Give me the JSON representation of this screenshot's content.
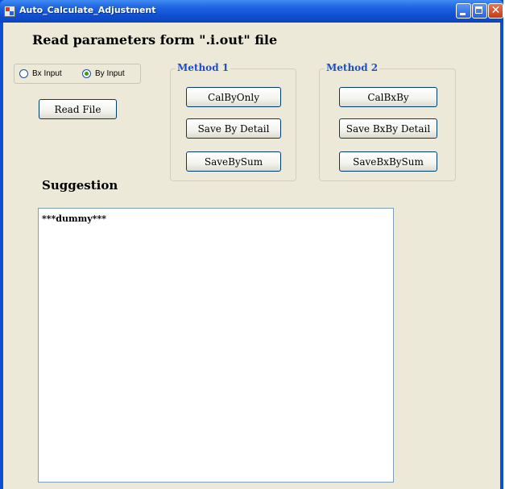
{
  "window": {
    "title": "Auto_Calculate_Adjustment"
  },
  "heading": "Read parameters form \".i.out\" file",
  "input_mode": {
    "options": [
      {
        "label": "Bx Input",
        "selected": false
      },
      {
        "label": "By Input",
        "selected": true
      }
    ]
  },
  "read_file_label": "Read File",
  "method1": {
    "title": "Method 1",
    "buttons": [
      "CalByOnly",
      "Save By Detail",
      "SaveBySum"
    ]
  },
  "method2": {
    "title": "Method 2",
    "buttons": [
      "CalBxBy",
      "Save BxBy Detail",
      "SaveBxBySum"
    ]
  },
  "suggestion": {
    "label": "Suggestion",
    "text": "***dummy***"
  },
  "colors": {
    "titlebar": "#0b46be",
    "client_bg": "#ece9d8",
    "group_title": "#1f4fc8",
    "radio_checked": "#2ea02e"
  }
}
